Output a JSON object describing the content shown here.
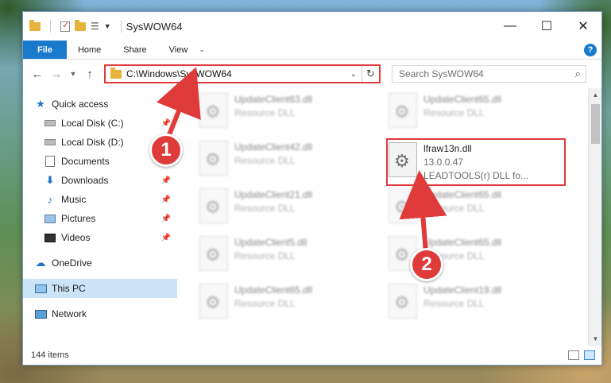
{
  "window": {
    "title": "SysWOW64"
  },
  "window_controls": {
    "minimize": "—",
    "maximize": "☐",
    "close": "✕"
  },
  "ribbon": {
    "tabs": [
      "File",
      "Home",
      "Share",
      "View"
    ],
    "help": "?"
  },
  "address": {
    "path": "C:\\Windows\\SysWOW64"
  },
  "search": {
    "placeholder": "Search SysWOW64"
  },
  "nav_pane": {
    "quick_access": "Quick access",
    "items": [
      {
        "label": "Local Disk (C:)",
        "icon": "drive-icon"
      },
      {
        "label": "Local Disk (D:)",
        "icon": "drive-icon"
      },
      {
        "label": "Documents",
        "icon": "documents-icon"
      },
      {
        "label": "Downloads",
        "icon": "downloads-icon"
      },
      {
        "label": "Music",
        "icon": "music-icon"
      },
      {
        "label": "Pictures",
        "icon": "pictures-icon"
      },
      {
        "label": "Videos",
        "icon": "videos-icon"
      }
    ],
    "onedrive": "OneDrive",
    "this_pc": "This PC",
    "network": "Network"
  },
  "files": [
    {
      "name": "UpdateClient63.dll",
      "type": "Resource DLL"
    },
    {
      "name": "UpdateClient65.dll",
      "type": "Resource DLL"
    },
    {
      "name": "UpdateClient42.dll",
      "type": "Resource DLL"
    },
    {
      "name": "lfraw13n.dll",
      "version": "13.0.0.47",
      "desc": "LEADTOOLS(r) DLL fo..."
    },
    {
      "name": "UpdateClient21.dll",
      "type": "Resource DLL"
    },
    {
      "name": "UpdateClient65.dll",
      "type": "Resource DLL"
    },
    {
      "name": "UpdateClient5.dll",
      "type": "Resource DLL"
    },
    {
      "name": "UpdateClient65.dll",
      "type": "Resource DLL"
    },
    {
      "name": "UpdateClient65.dll",
      "type": "Resource DLL"
    },
    {
      "name": "UpdateClient19.dll",
      "type": "Resource DLL"
    }
  ],
  "status": {
    "count": "144 items"
  },
  "annotations": {
    "step1": "1",
    "step2": "2",
    "color": "#e03b3b"
  }
}
